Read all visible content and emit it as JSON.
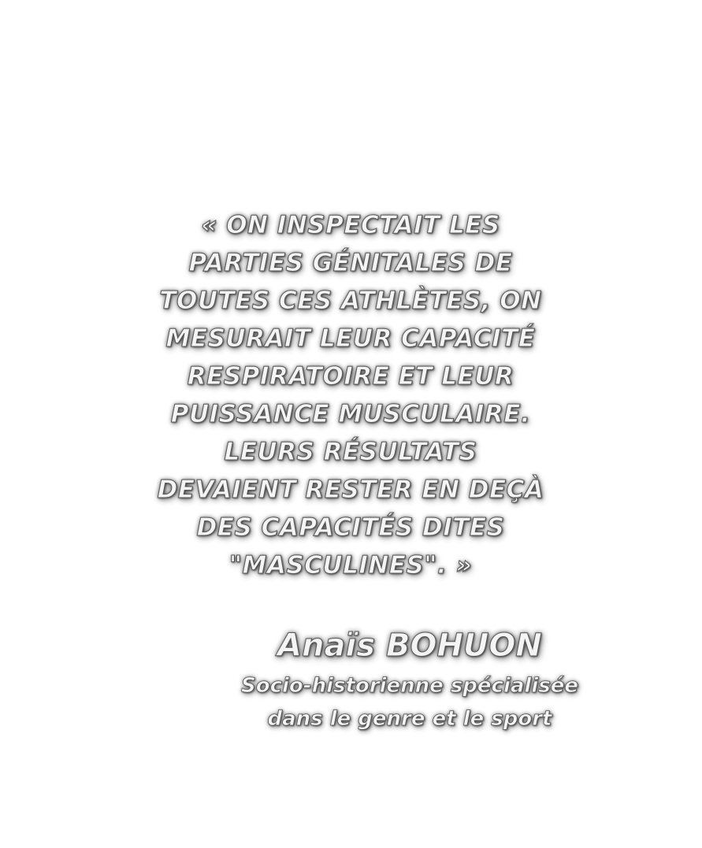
{
  "quote": {
    "lines": [
      "« ON INSPECTAIT LES",
      "PARTIES GÉNITALES DE",
      "TOUTES CES ATHLÈTES, ON",
      "MESURAIT LEUR CAPACITÉ",
      "RESPIRATOIRE ET LEUR",
      "PUISSANCE MUSCULAIRE.",
      "LEURS RÉSULTATS",
      "DEVAIENT RESTER EN DEÇÀ",
      "DES CAPACITÉS DITES",
      "\"MASCULINES\". »"
    ]
  },
  "author": {
    "name": "Anaïs BOHUON",
    "role_line1": "Socio-historienne spécialisée",
    "role_line2": "dans le genre et le sport"
  }
}
